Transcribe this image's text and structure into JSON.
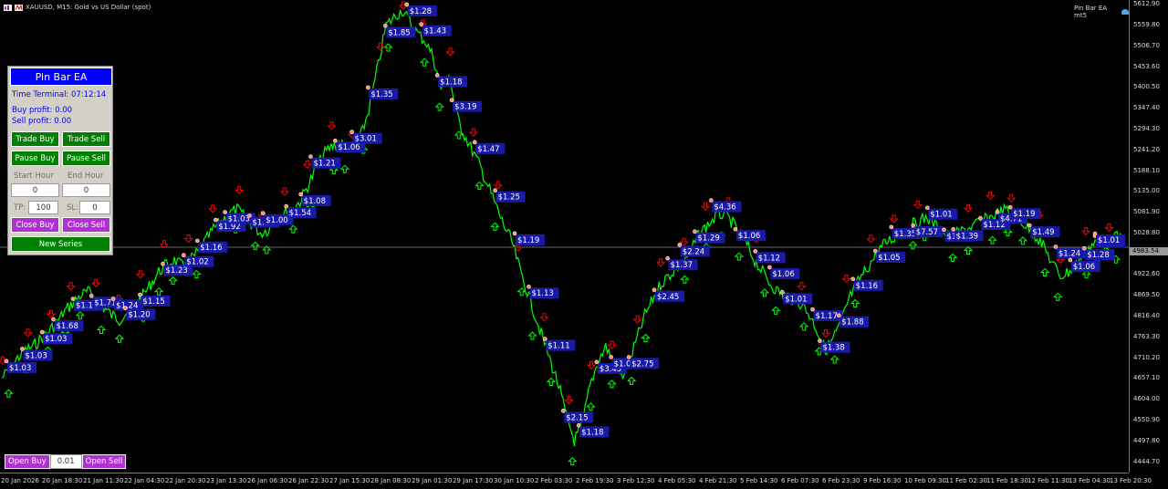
{
  "window": {
    "symbol_title": "XAUUSD, M15:  Gold vs US Dollar (spot)",
    "ea_name": "Pin Bar EA mt5",
    "icons": [
      "chart-icon",
      "mt5-logo-icon",
      "ea-hat-icon"
    ]
  },
  "colors": {
    "background": "#000000",
    "price_line": "#00ff00",
    "buy_arrow": "#00ff00",
    "sell_arrow": "#ff0000",
    "profit_label_bg": "#1a1aa8",
    "panel_header": "#0000ff",
    "panel_button_green": "#008000",
    "panel_button_purple": "#b22fd6"
  },
  "price_axis": {
    "labels": [
      "5612.90",
      "5559.80",
      "5506.70",
      "5453.60",
      "5400.50",
      "5347.40",
      "5294.30",
      "5241.20",
      "5188.10",
      "5135.00",
      "5081.90",
      "5028.80",
      "4922.60",
      "4869.50",
      "4816.40",
      "4763.30",
      "4710.20",
      "4657.10",
      "4604.00",
      "4550.90",
      "4497.80",
      "4444.70"
    ],
    "current_price": "4983.54"
  },
  "time_axis": {
    "labels": [
      "20 Jan 2026",
      "20 Jan 18:30",
      "21 Jan 11:30",
      "22 Jan 04:30",
      "22 Jan 20:30",
      "23 Jan 13:30",
      "26 Jan 06:30",
      "26 Jan 22:30",
      "27 Jan 15:30",
      "28 Jan 08:30",
      "29 Jan 01:30",
      "29 Jan 17:30",
      "30 Jan 10:30",
      "2 Feb 03:30",
      "2 Feb 19:30",
      "3 Feb 12:30",
      "4 Feb 05:30",
      "4 Feb 21:30",
      "5 Feb 14:30",
      "6 Feb 07:30",
      "6 Feb 23:30",
      "9 Feb 16:30",
      "10 Feb 09:30",
      "11 Feb 02:30",
      "11 Feb 18:30",
      "12 Feb 11:30",
      "13 Feb 04:30",
      "13 Feb 20:30"
    ]
  },
  "chart_data": {
    "type": "line",
    "title": "",
    "y_range": [
      4418,
      5625
    ],
    "series": [
      {
        "values": [
          4660,
          4680,
          4710,
          4730,
          4740,
          4760,
          4780,
          4800,
          4830,
          4850,
          4870,
          4880,
          4860,
          4840,
          4820,
          4810,
          4830,
          4850,
          4870,
          4900,
          4930,
          4950,
          4960,
          4945,
          4960,
          4980,
          5010,
          5040,
          5060,
          5080,
          5090,
          5070,
          5050,
          5030,
          5040,
          5060,
          5080,
          5090,
          5110,
          5150,
          5190,
          5230,
          5250,
          5260,
          5250,
          5240,
          5290,
          5360,
          5460,
          5560,
          5580,
          5600,
          5570,
          5540,
          5520,
          5480,
          5400,
          5440,
          5330,
          5280,
          5240,
          5200,
          5150,
          5100,
          5050,
          5010,
          4940,
          4880,
          4820,
          4760,
          4700,
          4640,
          4560,
          4500,
          4540,
          4640,
          4700,
          4740,
          4700,
          4660,
          4700,
          4760,
          4820,
          4860,
          4900,
          4920,
          4940,
          4960,
          4990,
          5030,
          5050,
          5070,
          5080,
          5060,
          5030,
          5000,
          4960,
          4930,
          4900,
          4880,
          4870,
          4860,
          4850,
          4820,
          4780,
          4730,
          4760,
          4800,
          4860,
          4900,
          4930,
          4960,
          4990,
          5010,
          5020,
          5030,
          5050,
          5060,
          5070,
          5050,
          5030,
          5020,
          5030,
          5040,
          5050,
          5060,
          5070,
          5080,
          5090,
          5070,
          5060,
          5040,
          5020,
          4990,
          4950,
          4920,
          4930,
          4950,
          4980,
          5000,
          5010,
          5000,
          5020,
          5010
        ]
      }
    ],
    "profit_labels": [
      "$1.03",
      "$1.03",
      "$1.03",
      "$1.68",
      "$1.10",
      "$1.71",
      "$1.24",
      "$1.20",
      "$1.15",
      "$1.23",
      "$1.02",
      "$1.16",
      "$1.92",
      "$1.03",
      "$1.29",
      "$1.00",
      "$1.54",
      "$1.08",
      "$1.21",
      "$1.06",
      "$3.01",
      "$1.35",
      "$1.85",
      "$1.28",
      "$1.43",
      "$1.18",
      "$3.19",
      "$1.47",
      "$1.25",
      "$1.19",
      "$1.13",
      "$1.11",
      "$2.15",
      "$1.18",
      "$3.43",
      "$1.00",
      "$2.75",
      "$2.45",
      "$1.37",
      "$2.24",
      "$1.29",
      "$4.36",
      "$1.06",
      "$1.12",
      "$1.06",
      "$1.01",
      "$1.17",
      "$1.38",
      "$1.88",
      "$1.16",
      "$1.05",
      "$1.35",
      "$7.57",
      "$1.01",
      "$1.76",
      "$1.39",
      "$1.12",
      "$4.71",
      "$1.19",
      "$1.49",
      "$1.24",
      "$1.06",
      "$1.28",
      "$1.35",
      "$1.01"
    ],
    "buy_arrow_count": 60,
    "sell_arrow_count": 48
  },
  "panel": {
    "title": "Pin Bar EA",
    "time_terminal": "Time Terminal: 07:12:14",
    "buy_profit": "Buy profit: 0.00",
    "sell_profit": "Sell profit: 0.00",
    "trade_buy": "Trade Buy",
    "trade_sell": "Trade Sell",
    "pause_buy": "Pause Buy",
    "pause_sell": "Pause Sell",
    "start_hour_label": "Start Hour",
    "end_hour_label": "End Hour",
    "start_hour_value": "0",
    "end_hour_value": "0",
    "tp_label": "TP:",
    "tp_value": "100",
    "sl_label": "SL:",
    "sl_value": "0",
    "close_buy": "Close Buy",
    "close_sell": "Close Sell",
    "new_series": "New Series"
  },
  "trade_bar": {
    "open_buy": "Open Buy",
    "lot": "0.01",
    "open_sell": "Open Sell"
  }
}
